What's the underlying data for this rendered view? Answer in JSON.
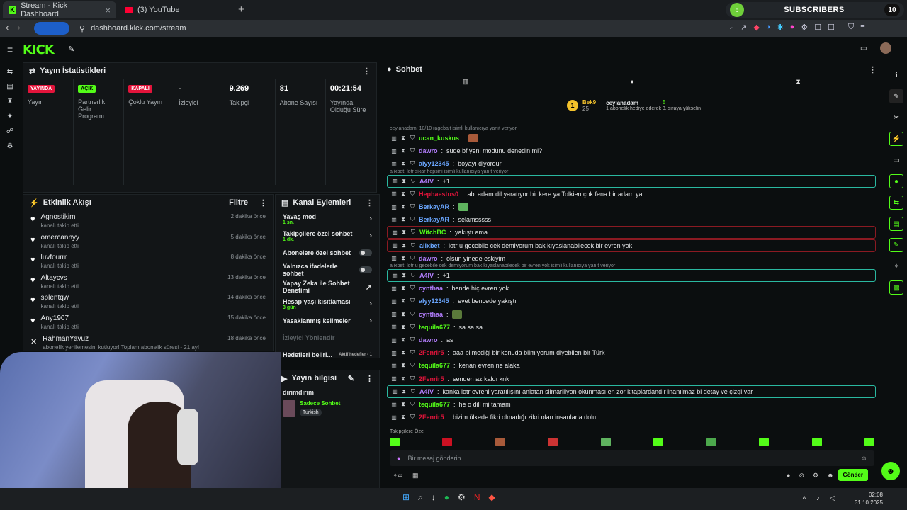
{
  "browser": {
    "tabs": [
      {
        "label": "Stream - Kick Dashboard",
        "active": true
      },
      {
        "label": "(3) YouTube",
        "active": false
      }
    ],
    "url": "dashboard.kick.com/stream",
    "subscribers": {
      "label": "SUBSCRIBERS",
      "count": "10",
      "avatar": "o"
    }
  },
  "stats": {
    "title": "Yayın İstatistikleri",
    "items": [
      {
        "badge": "YAYINDA",
        "badge_color": "red",
        "label": "Yayın",
        "value": ""
      },
      {
        "badge": "AÇIK",
        "badge_color": "green",
        "label": "Partnerlik Gelir Programı",
        "value": ""
      },
      {
        "badge": "KAPALI",
        "badge_color": "red",
        "label": "Çoklu Yayın",
        "value": ""
      },
      {
        "badge": "",
        "label": "İzleyici",
        "value": "-"
      },
      {
        "badge": "",
        "label": "Takipçi",
        "value": "9.269"
      },
      {
        "badge": "",
        "label": "Abone Sayısı",
        "value": "81"
      },
      {
        "badge": "",
        "label": "Yayında Olduğu Süre",
        "value": "00:21:54"
      }
    ]
  },
  "activity": {
    "title": "Etkinlik Akışı",
    "filter": "Filtre",
    "events": [
      {
        "name": "Agnostikim",
        "desc": "kanalı takip etti",
        "time": "2 dakika önce"
      },
      {
        "name": "omercannyy",
        "desc": "kanalı takip etti",
        "time": "5 dakika önce"
      },
      {
        "name": "luvfourrr",
        "desc": "kanalı takip etti",
        "time": "8 dakika önce"
      },
      {
        "name": "Altaycvs",
        "desc": "kanalı takip etti",
        "time": "13 dakika önce"
      },
      {
        "name": "splentqw",
        "desc": "kanalı takip etti",
        "time": "14 dakika önce"
      },
      {
        "name": "Any1907",
        "desc": "kanalı takip etti",
        "time": "15 dakika önce"
      },
      {
        "name": "RahmanYavuz",
        "desc": "abonelik yenilemesini kutluyor! Toplam abonelik süresi - 21 ay!",
        "time": "18 dakika önce"
      }
    ]
  },
  "channel_actions": {
    "title": "Kanal Eylemleri",
    "items": [
      {
        "label": "Yavaş mod",
        "sub": "1 sn.",
        "control": "chevron"
      },
      {
        "label": "Takipçilere özel sohbet",
        "sub": "1 dk.",
        "control": "chevron"
      },
      {
        "label": "Abonelere özel sohbet",
        "sub": "",
        "control": "toggle"
      },
      {
        "label": "Yalnızca ifadelerle sohbet",
        "sub": "",
        "control": "toggle"
      },
      {
        "label": "Yapay Zeka ile Sohbet Denetimi",
        "sub": "",
        "control": "external"
      },
      {
        "label": "Hesap yaşı kısıtlaması",
        "sub": "3 gün",
        "control": "chevron"
      },
      {
        "label": "Yasaklanmış kelimeler",
        "sub": "",
        "control": "chevron"
      },
      {
        "label": "İzleyici Yönlendir",
        "sub": "",
        "control": ""
      },
      {
        "label": "Hedefleri belirl...",
        "sub": "",
        "control": "goal",
        "goal_text": "Aktif hedefler - 1"
      }
    ]
  },
  "stream_info": {
    "title": "Yayın bilgisi",
    "stream_title": "dırımdırım",
    "category": "Sadece Sohbet",
    "language": "Turkish"
  },
  "chat": {
    "title": "Sohbet",
    "leader": {
      "rank": "1",
      "name": "Bek9",
      "score": "25",
      "user": "ceylanadam",
      "count": "5",
      "note": "1 abonelik hediye ederek 3. sıraya yükselin"
    },
    "messages": [
      {
        "reply": "ceylanadam: 10/10 ragebait isimli kullanıcıya yanıt veriyor"
      },
      {
        "user": "ucan_kuskus",
        "color": "#53fc18",
        "text": "",
        "emote": "#a85a3a"
      },
      {
        "user": "dawro",
        "color": "#b47fff",
        "text": "sude bf yeni modunu denedin mi?"
      },
      {
        "user": "alyy12345",
        "color": "#6aa6ff",
        "text": "boyayı diyordur"
      },
      {
        "reply": "alixbet: lotr sikar hepsini isimli kullanıcıya yanıt veriyor"
      },
      {
        "user": "A4IV",
        "color": "#b47fff",
        "text": "+1",
        "style": "hl"
      },
      {
        "user": "Hephaestus0",
        "color": "#e3143b",
        "text": "abi adam dil yaratıyor bir kere ya Tolkien çok fena bir adam ya"
      },
      {
        "user": "BerkayAR",
        "color": "#6aa6ff",
        "text": "",
        "emote": "#5fb35f"
      },
      {
        "user": "BerkayAR",
        "color": "#6aa6ff",
        "text": "selamsssss"
      },
      {
        "user": "WitchBC",
        "color": "#53fc18",
        "text": "yakıştı ama",
        "style": "red"
      },
      {
        "user": "alixbet",
        "color": "#6aa6ff",
        "text": "lotr u gecebile cek demiyorum bak kıyaslanabilecek bir evren yok",
        "style": "red"
      },
      {
        "user": "dawro",
        "color": "#b47fff",
        "text": "olsun yinede eskiyim"
      },
      {
        "reply": "alixbet: lotr u gecebile cek demiyorum bak kıyaslanabilecek bir evren yok isimli kullanıcıya yanıt veriyor"
      },
      {
        "user": "A4IV",
        "color": "#b47fff",
        "text": "+1",
        "style": "hl"
      },
      {
        "user": "cynthaa",
        "color": "#b47fff",
        "text": "bende hiç evren yok"
      },
      {
        "user": "alyy12345",
        "color": "#6aa6ff",
        "text": "evet bencede yakıştı"
      },
      {
        "user": "cynthaa",
        "color": "#b47fff",
        "text": "",
        "emote": "#5a7a3a"
      },
      {
        "user": "tequila677",
        "color": "#53fc18",
        "text": "sa sa sa"
      },
      {
        "user": "dawro",
        "color": "#b47fff",
        "text": "as"
      },
      {
        "user": "2Fenrir5",
        "color": "#e3143b",
        "text": "aaa bilmediği bir konuda bilmiyorum diyebilen bir Türk"
      },
      {
        "user": "tequila677",
        "color": "#53fc18",
        "text": "kenan evren ne alaka"
      },
      {
        "user": "2Fenrir5",
        "color": "#e3143b",
        "text": "senden az kaldı knk"
      },
      {
        "user": "A4IV",
        "color": "#b47fff",
        "text": "kanka lotr evreni yaratılışını anlatan silmariliyon okunması en zor kitaplardandır inanılmaz bi detay ve çizgi var",
        "style": "hl"
      },
      {
        "user": "tequila677",
        "color": "#53fc18",
        "text": "he o dill mi tamam"
      },
      {
        "user": "2Fenrir5",
        "color": "#e3143b",
        "text": "bizim ülkede fikri olmadığı zikri olan insanlarla dolu"
      }
    ],
    "followers_only": "Takipçilere Özel",
    "input_placeholder": "Bir mesaj gönderin",
    "send": "Gönder"
  },
  "taskbar": {
    "time": "02:08",
    "date": "31.10.2025"
  }
}
